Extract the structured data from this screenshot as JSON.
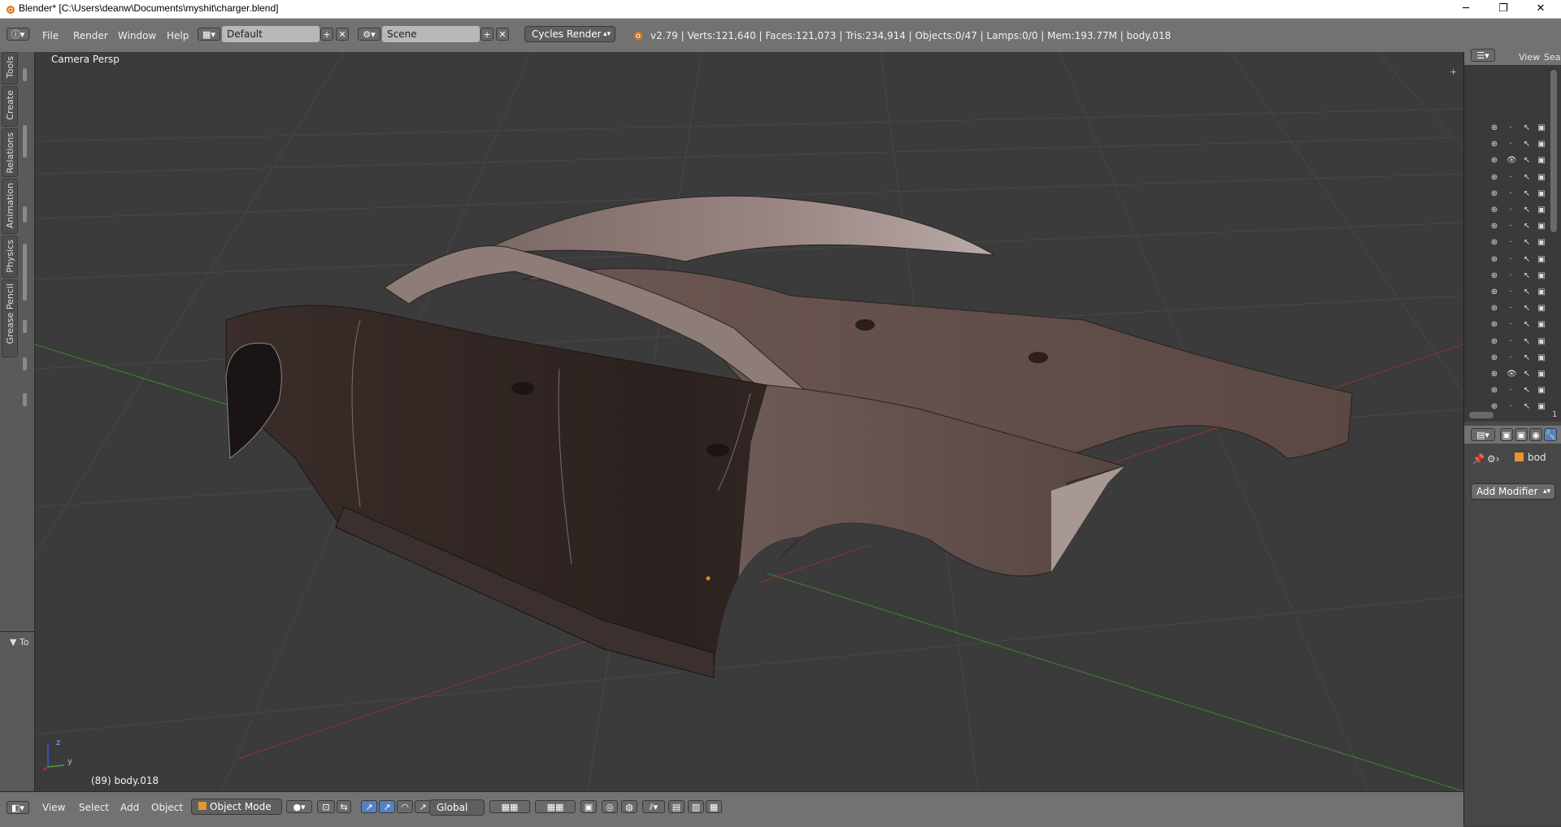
{
  "window": {
    "title": "Blender* [C:\\Users\\deanw\\Documents\\myshit\\charger.blend]",
    "minimize": "─",
    "maximize": "❐",
    "close": "✕"
  },
  "infobar": {
    "menus": [
      "File",
      "Render",
      "Window",
      "Help"
    ],
    "layout_field": "Default",
    "scene_field": "Scene",
    "render_engine": "Cycles Render",
    "stats": "v2.79 | Verts:121,640 | Faces:121,073 | Tris:234,914 | Objects:0/47 | Lamps:0/0 | Mem:193.77M | body.018"
  },
  "left_toolbar": {
    "tabs": [
      "Tools",
      "Create",
      "Relations",
      "Animation",
      "Physics",
      "Grease Pencil"
    ],
    "operator_panel": "▼ To"
  },
  "viewport": {
    "view_name": "Camera Persp",
    "object_info": "(89) body.018",
    "axis_z": "z",
    "axis_y": "y"
  },
  "bottombar": {
    "menus": [
      "View",
      "Select",
      "Add",
      "Object"
    ],
    "mode": "Object Mode",
    "orientation": "Global"
  },
  "right_panel": {
    "outliner_view": "View",
    "outliner_search": "Sear",
    "scroll_index": "1",
    "object_name": "bod",
    "add_modifier": "Add Modifier"
  },
  "colors": {
    "car_body": "#6f5a55",
    "car_dark": "#2c221f",
    "grid": "#4a4a4a",
    "x_axis": "#8a3030",
    "y_axis": "#3a7a30",
    "accent": "#e58a1f"
  }
}
